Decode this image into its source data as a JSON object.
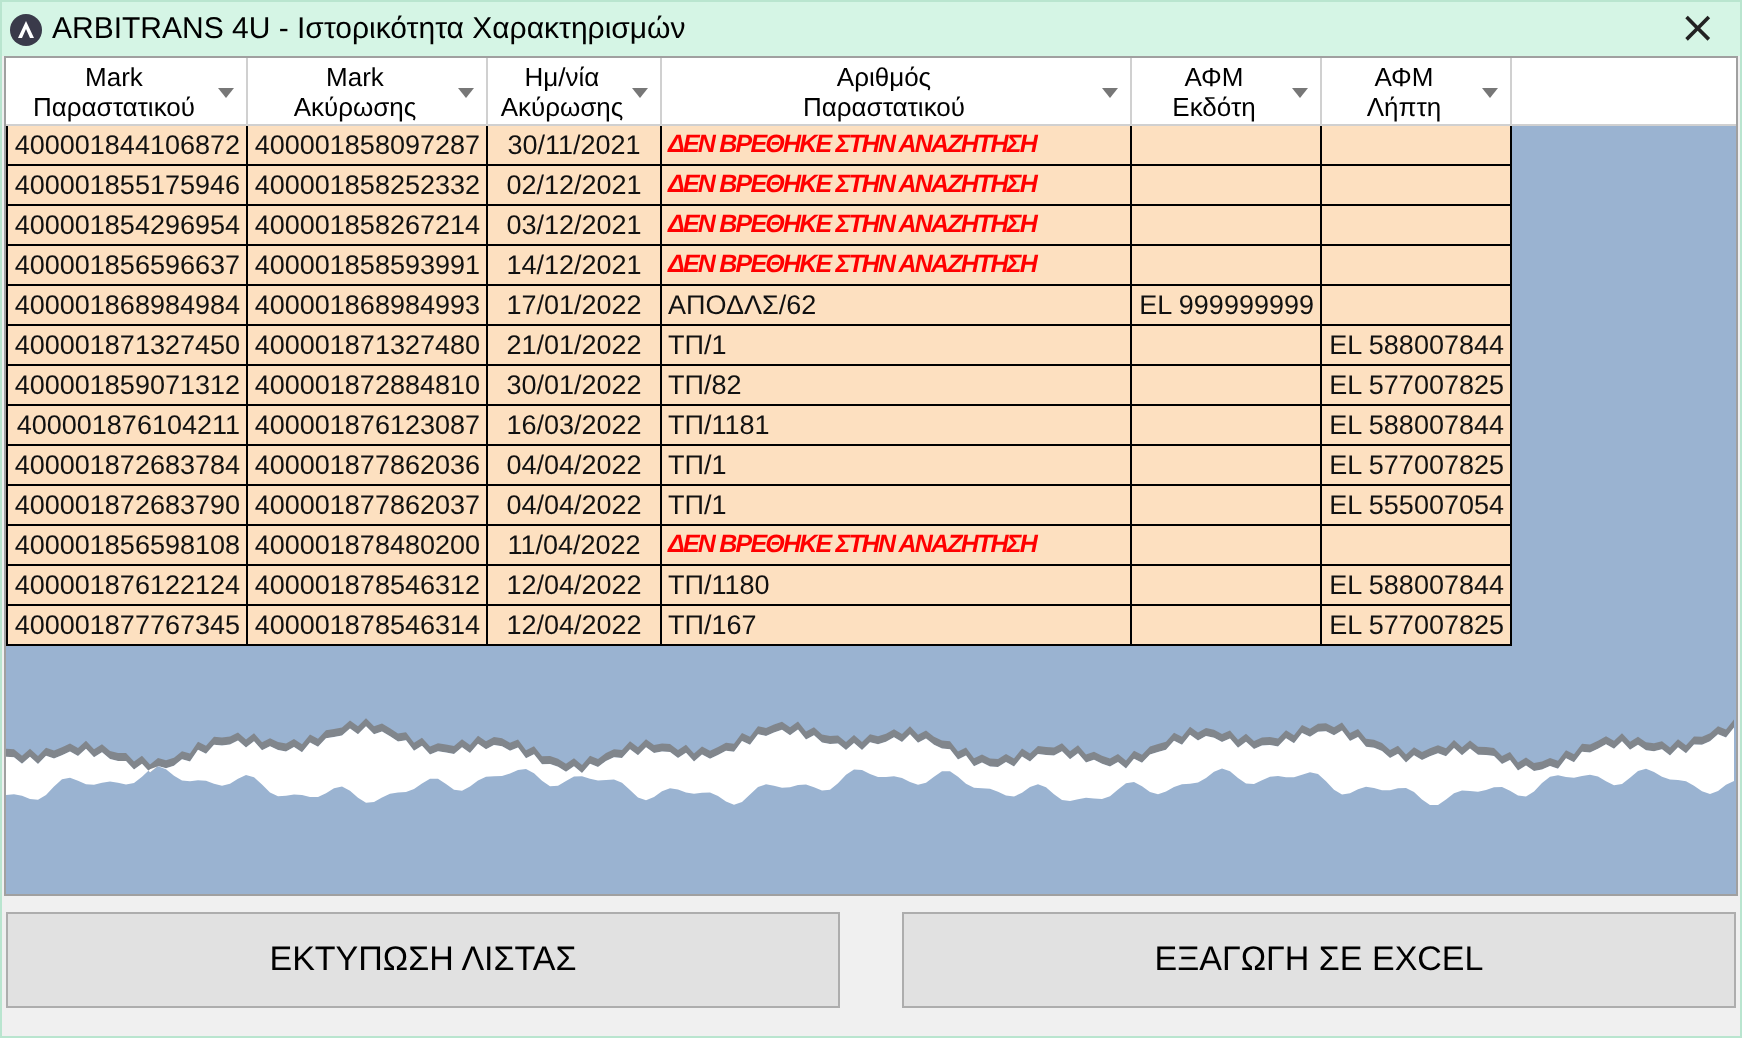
{
  "window": {
    "title": "ARBITRANS 4U - Ιστορικότητα Χαρακτηρισμών",
    "close": "×"
  },
  "table": {
    "columns": [
      {
        "label": "Mark Παραστατικού"
      },
      {
        "label": "Mark Ακύρωσης"
      },
      {
        "label": "Ημ/νία Ακύρωσης"
      },
      {
        "label": "Αριθμός Παραστατικού"
      },
      {
        "label": "ΑΦΜ Εκδότη"
      },
      {
        "label": "ΑΦΜ Λήπτη"
      }
    ],
    "rows": [
      {
        "cells": [
          "400001844106872",
          "400001858097287",
          "30/11/2021",
          "ΔΕΝ ΒΡΕΘΗΚΕ ΣΤΗΝ ΑΝΑΖΗΤΗΣΗ"
        ],
        "not_found": true
      },
      {
        "cells": [
          "400001855175946",
          "400001858252332",
          "02/12/2021",
          "ΔΕΝ ΒΡΕΘΗΚΕ ΣΤΗΝ ΑΝΑΖΗΤΗΣΗ"
        ],
        "not_found": true
      },
      {
        "cells": [
          "400001854296954",
          "400001858267214",
          "03/12/2021",
          "ΔΕΝ ΒΡΕΘΗΚΕ ΣΤΗΝ ΑΝΑΖΗΤΗΣΗ"
        ],
        "not_found": true
      },
      {
        "cells": [
          "400001856596637",
          "400001858593991",
          "14/12/2021",
          "ΔΕΝ ΒΡΕΘΗΚΕ ΣΤΗΝ ΑΝΑΖΗΤΗΣΗ"
        ],
        "not_found": true
      },
      {
        "cells": [
          "400001868984984",
          "400001868984993",
          "17/01/2022",
          "ΑΠΟΔΛΣ/62",
          "EL 999999999",
          null
        ],
        "not_found": false
      },
      {
        "cells": [
          "400001871327450",
          "400001871327480",
          "21/01/2022",
          "ΤΠ/1",
          null,
          "EL 588007844"
        ],
        "not_found": false
      },
      {
        "cells": [
          "400001859071312",
          "400001872884810",
          "30/01/2022",
          "ΤΠ/82",
          null,
          "EL 577007825"
        ],
        "not_found": false
      },
      {
        "cells": [
          "400001876104211",
          "400001876123087",
          "16/03/2022",
          "ΤΠ/1181",
          null,
          "EL 588007844"
        ],
        "not_found": false
      },
      {
        "cells": [
          "400001872683784",
          "400001877862036",
          "04/04/2022",
          "ΤΠ/1",
          null,
          "EL 577007825"
        ],
        "not_found": false
      },
      {
        "cells": [
          "400001872683790",
          "400001877862037",
          "04/04/2022",
          "ΤΠ/1",
          null,
          "EL 555007054"
        ],
        "not_found": false
      },
      {
        "cells": [
          "400001856598108",
          "400001878480200",
          "11/04/2022",
          "ΔΕΝ ΒΡΕΘΗΚΕ ΣΤΗΝ ΑΝΑΖΗΤΗΣΗ"
        ],
        "not_found": true
      },
      {
        "cells": [
          "400001876122124",
          "400001878546312",
          "12/04/2022",
          "ΤΠ/1180",
          null,
          "EL 588007844"
        ],
        "not_found": false
      },
      {
        "cells": [
          "400001877767345",
          "400001878546314",
          "12/04/2022",
          "ΤΠ/167",
          null,
          "EL 577007825"
        ],
        "not_found": false
      }
    ]
  },
  "buttons": [
    {
      "label": "ΕΚΤΥΠΩΣΗ ΛΙΣΤΑΣ"
    },
    {
      "label": "ΕΞΑΓΩΓΗ ΣΕ EXCEL"
    }
  ]
}
